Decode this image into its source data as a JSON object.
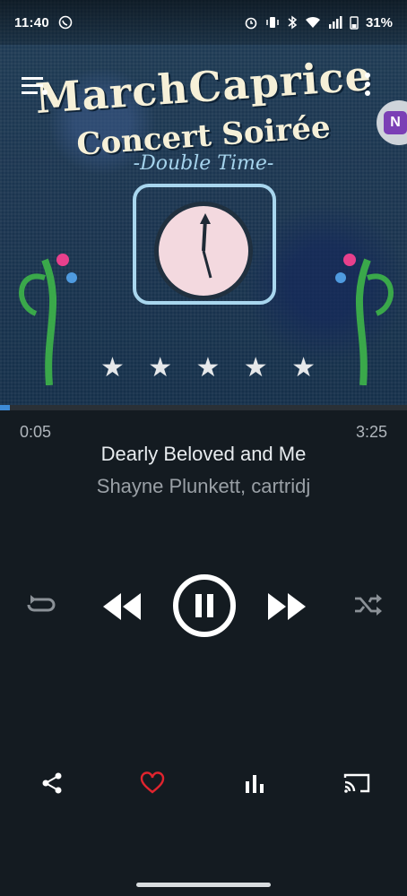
{
  "status_bar": {
    "time": "11:40",
    "battery": "31%",
    "icons": [
      "whatsapp-icon",
      "alarm-icon",
      "vibrate-icon",
      "bluetooth-icon",
      "wifi-icon",
      "signal-icon",
      "battery-icon"
    ]
  },
  "album_art": {
    "title_line1": "MarchCaprice",
    "title_line2": "Concert Soirée",
    "subtitle": "-Double Time-"
  },
  "rating": {
    "value": 5,
    "max": 5
  },
  "track": {
    "elapsed": "0:05",
    "duration": "3:25",
    "progress_fraction": 0.024,
    "title": "Dearly Beloved and Me",
    "artist": "Shayne Plunkett, cartridj"
  },
  "controls": [
    "repeat-icon",
    "previous-icon",
    "pause-icon",
    "next-icon",
    "shuffle-icon"
  ],
  "bottom_actions": [
    "share-icon",
    "heart-icon",
    "equalizer-icon",
    "cast-icon"
  ],
  "side_bubble_app": "N",
  "colors": {
    "background": "#141b21",
    "accent": "#3e8bd6",
    "heart": "#e0242e",
    "secondary_text": "#9aa0a6"
  }
}
